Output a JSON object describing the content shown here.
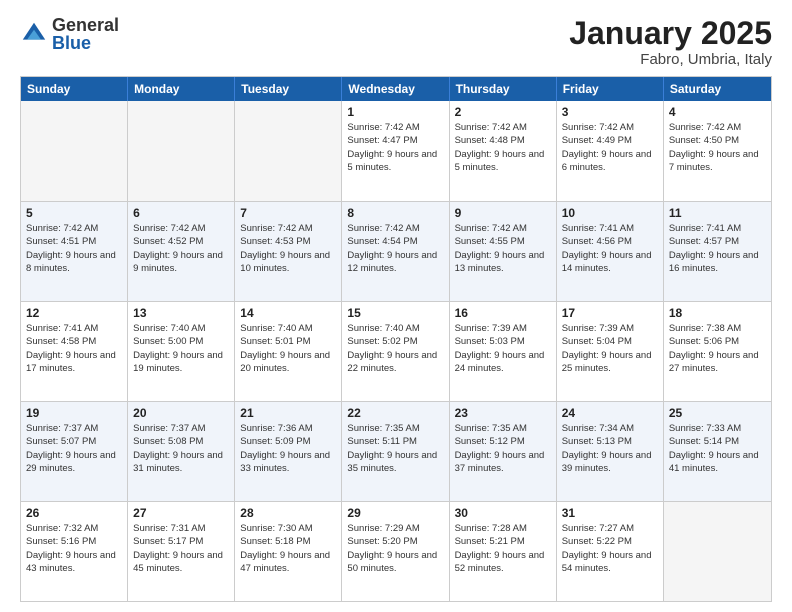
{
  "logo": {
    "general": "General",
    "blue": "Blue"
  },
  "title": "January 2025",
  "location": "Fabro, Umbria, Italy",
  "weekdays": [
    "Sunday",
    "Monday",
    "Tuesday",
    "Wednesday",
    "Thursday",
    "Friday",
    "Saturday"
  ],
  "weeks": [
    [
      {
        "day": "",
        "sunrise": "",
        "sunset": "",
        "daylight": "",
        "empty": true
      },
      {
        "day": "",
        "sunrise": "",
        "sunset": "",
        "daylight": "",
        "empty": true
      },
      {
        "day": "",
        "sunrise": "",
        "sunset": "",
        "daylight": "",
        "empty": true
      },
      {
        "day": "1",
        "sunrise": "Sunrise: 7:42 AM",
        "sunset": "Sunset: 4:47 PM",
        "daylight": "Daylight: 9 hours and 5 minutes.",
        "empty": false
      },
      {
        "day": "2",
        "sunrise": "Sunrise: 7:42 AM",
        "sunset": "Sunset: 4:48 PM",
        "daylight": "Daylight: 9 hours and 5 minutes.",
        "empty": false
      },
      {
        "day": "3",
        "sunrise": "Sunrise: 7:42 AM",
        "sunset": "Sunset: 4:49 PM",
        "daylight": "Daylight: 9 hours and 6 minutes.",
        "empty": false
      },
      {
        "day": "4",
        "sunrise": "Sunrise: 7:42 AM",
        "sunset": "Sunset: 4:50 PM",
        "daylight": "Daylight: 9 hours and 7 minutes.",
        "empty": false
      }
    ],
    [
      {
        "day": "5",
        "sunrise": "Sunrise: 7:42 AM",
        "sunset": "Sunset: 4:51 PM",
        "daylight": "Daylight: 9 hours and 8 minutes.",
        "empty": false
      },
      {
        "day": "6",
        "sunrise": "Sunrise: 7:42 AM",
        "sunset": "Sunset: 4:52 PM",
        "daylight": "Daylight: 9 hours and 9 minutes.",
        "empty": false
      },
      {
        "day": "7",
        "sunrise": "Sunrise: 7:42 AM",
        "sunset": "Sunset: 4:53 PM",
        "daylight": "Daylight: 9 hours and 10 minutes.",
        "empty": false
      },
      {
        "day": "8",
        "sunrise": "Sunrise: 7:42 AM",
        "sunset": "Sunset: 4:54 PM",
        "daylight": "Daylight: 9 hours and 12 minutes.",
        "empty": false
      },
      {
        "day": "9",
        "sunrise": "Sunrise: 7:42 AM",
        "sunset": "Sunset: 4:55 PM",
        "daylight": "Daylight: 9 hours and 13 minutes.",
        "empty": false
      },
      {
        "day": "10",
        "sunrise": "Sunrise: 7:41 AM",
        "sunset": "Sunset: 4:56 PM",
        "daylight": "Daylight: 9 hours and 14 minutes.",
        "empty": false
      },
      {
        "day": "11",
        "sunrise": "Sunrise: 7:41 AM",
        "sunset": "Sunset: 4:57 PM",
        "daylight": "Daylight: 9 hours and 16 minutes.",
        "empty": false
      }
    ],
    [
      {
        "day": "12",
        "sunrise": "Sunrise: 7:41 AM",
        "sunset": "Sunset: 4:58 PM",
        "daylight": "Daylight: 9 hours and 17 minutes.",
        "empty": false
      },
      {
        "day": "13",
        "sunrise": "Sunrise: 7:40 AM",
        "sunset": "Sunset: 5:00 PM",
        "daylight": "Daylight: 9 hours and 19 minutes.",
        "empty": false
      },
      {
        "day": "14",
        "sunrise": "Sunrise: 7:40 AM",
        "sunset": "Sunset: 5:01 PM",
        "daylight": "Daylight: 9 hours and 20 minutes.",
        "empty": false
      },
      {
        "day": "15",
        "sunrise": "Sunrise: 7:40 AM",
        "sunset": "Sunset: 5:02 PM",
        "daylight": "Daylight: 9 hours and 22 minutes.",
        "empty": false
      },
      {
        "day": "16",
        "sunrise": "Sunrise: 7:39 AM",
        "sunset": "Sunset: 5:03 PM",
        "daylight": "Daylight: 9 hours and 24 minutes.",
        "empty": false
      },
      {
        "day": "17",
        "sunrise": "Sunrise: 7:39 AM",
        "sunset": "Sunset: 5:04 PM",
        "daylight": "Daylight: 9 hours and 25 minutes.",
        "empty": false
      },
      {
        "day": "18",
        "sunrise": "Sunrise: 7:38 AM",
        "sunset": "Sunset: 5:06 PM",
        "daylight": "Daylight: 9 hours and 27 minutes.",
        "empty": false
      }
    ],
    [
      {
        "day": "19",
        "sunrise": "Sunrise: 7:37 AM",
        "sunset": "Sunset: 5:07 PM",
        "daylight": "Daylight: 9 hours and 29 minutes.",
        "empty": false
      },
      {
        "day": "20",
        "sunrise": "Sunrise: 7:37 AM",
        "sunset": "Sunset: 5:08 PM",
        "daylight": "Daylight: 9 hours and 31 minutes.",
        "empty": false
      },
      {
        "day": "21",
        "sunrise": "Sunrise: 7:36 AM",
        "sunset": "Sunset: 5:09 PM",
        "daylight": "Daylight: 9 hours and 33 minutes.",
        "empty": false
      },
      {
        "day": "22",
        "sunrise": "Sunrise: 7:35 AM",
        "sunset": "Sunset: 5:11 PM",
        "daylight": "Daylight: 9 hours and 35 minutes.",
        "empty": false
      },
      {
        "day": "23",
        "sunrise": "Sunrise: 7:35 AM",
        "sunset": "Sunset: 5:12 PM",
        "daylight": "Daylight: 9 hours and 37 minutes.",
        "empty": false
      },
      {
        "day": "24",
        "sunrise": "Sunrise: 7:34 AM",
        "sunset": "Sunset: 5:13 PM",
        "daylight": "Daylight: 9 hours and 39 minutes.",
        "empty": false
      },
      {
        "day": "25",
        "sunrise": "Sunrise: 7:33 AM",
        "sunset": "Sunset: 5:14 PM",
        "daylight": "Daylight: 9 hours and 41 minutes.",
        "empty": false
      }
    ],
    [
      {
        "day": "26",
        "sunrise": "Sunrise: 7:32 AM",
        "sunset": "Sunset: 5:16 PM",
        "daylight": "Daylight: 9 hours and 43 minutes.",
        "empty": false
      },
      {
        "day": "27",
        "sunrise": "Sunrise: 7:31 AM",
        "sunset": "Sunset: 5:17 PM",
        "daylight": "Daylight: 9 hours and 45 minutes.",
        "empty": false
      },
      {
        "day": "28",
        "sunrise": "Sunrise: 7:30 AM",
        "sunset": "Sunset: 5:18 PM",
        "daylight": "Daylight: 9 hours and 47 minutes.",
        "empty": false
      },
      {
        "day": "29",
        "sunrise": "Sunrise: 7:29 AM",
        "sunset": "Sunset: 5:20 PM",
        "daylight": "Daylight: 9 hours and 50 minutes.",
        "empty": false
      },
      {
        "day": "30",
        "sunrise": "Sunrise: 7:28 AM",
        "sunset": "Sunset: 5:21 PM",
        "daylight": "Daylight: 9 hours and 52 minutes.",
        "empty": false
      },
      {
        "day": "31",
        "sunrise": "Sunrise: 7:27 AM",
        "sunset": "Sunset: 5:22 PM",
        "daylight": "Daylight: 9 hours and 54 minutes.",
        "empty": false
      },
      {
        "day": "",
        "sunrise": "",
        "sunset": "",
        "daylight": "",
        "empty": true
      }
    ]
  ]
}
